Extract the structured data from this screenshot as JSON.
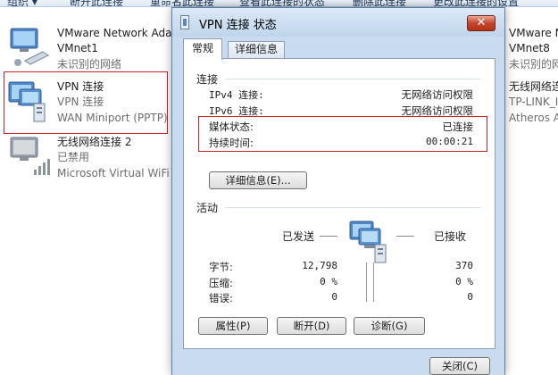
{
  "toolbar": {
    "items": [
      "组织 ▾",
      "断开此连接",
      "重命名此连接",
      "查看此连接的状态",
      "删除此连接",
      "更改此连接的设置"
    ]
  },
  "adapters": {
    "vmnet1": {
      "name": "VMware Network Ada",
      "sub": "VMnet1",
      "status": "未识别的网络"
    },
    "vpn": {
      "name": "VPN 连接",
      "sub": "VPN 连接",
      "status": "WAN Miniport (PPTP)"
    },
    "wireless2": {
      "name": "无线网络连接 2",
      "sub": "已禁用",
      "status": "Microsoft Virtual WiFi"
    },
    "vmnet8": {
      "name": "VMware Network Ada",
      "sub": "VMnet8",
      "status": "未识别的网络"
    },
    "wireless": {
      "name": "无线网络连接",
      "sub": "TP-LINK_I",
      "status": "Atheros A"
    }
  },
  "dialog": {
    "title": "VPN 连接 状态",
    "close_label": "✕",
    "tabs": [
      "常规",
      "详细信息"
    ],
    "connection": {
      "heading": "连接",
      "rows": [
        {
          "label": "IPv4 连接:",
          "value": "无网络访问权限"
        },
        {
          "label": "IPv6 连接:",
          "value": "无网络访问权限"
        },
        {
          "label": "媒体状态:",
          "value": "已连接"
        },
        {
          "label": "持续时间:",
          "value": "00:00:21"
        }
      ]
    },
    "details_button": "详细信息(E)...",
    "activity": {
      "heading": "活动",
      "sent_label": "已发送",
      "received_label": "已接收",
      "rows": [
        {
          "label": "字节:",
          "sent": "12,798",
          "received": "370"
        },
        {
          "label": "压缩:",
          "sent": "0 %",
          "received": "0 %"
        },
        {
          "label": "错误:",
          "sent": "0",
          "received": "0"
        }
      ]
    },
    "buttons": {
      "properties": "属性(P)",
      "disconnect": "断开(D)",
      "diagnose": "诊断(G)"
    },
    "close_button": "关闭(C)"
  },
  "colors": {
    "highlight_border": "#c8202b",
    "dialog_frame": "#c9dcef",
    "close_red": "#c4452b"
  }
}
